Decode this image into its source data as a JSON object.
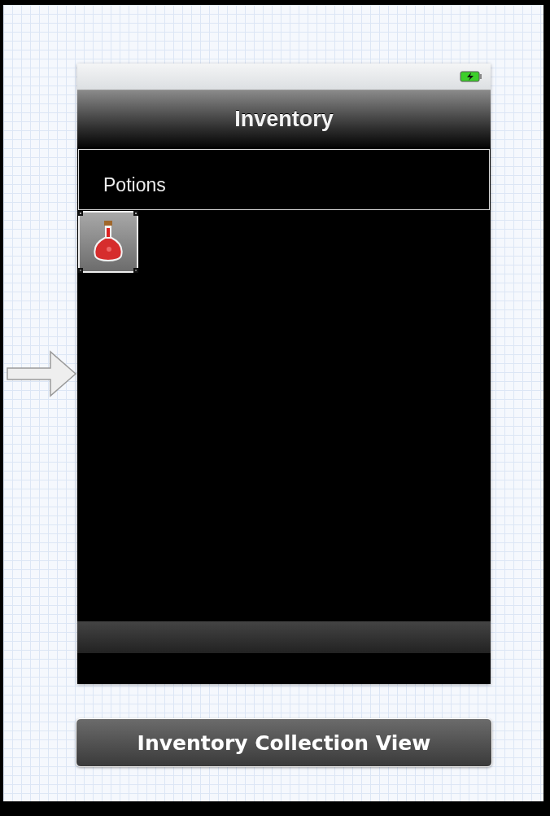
{
  "navigation_bar": {
    "title": "Inventory"
  },
  "section_header": {
    "title": "Potions"
  },
  "collection": {
    "cells": [
      {
        "selected": true
      }
    ]
  },
  "scene_label": "Inventory Collection View"
}
